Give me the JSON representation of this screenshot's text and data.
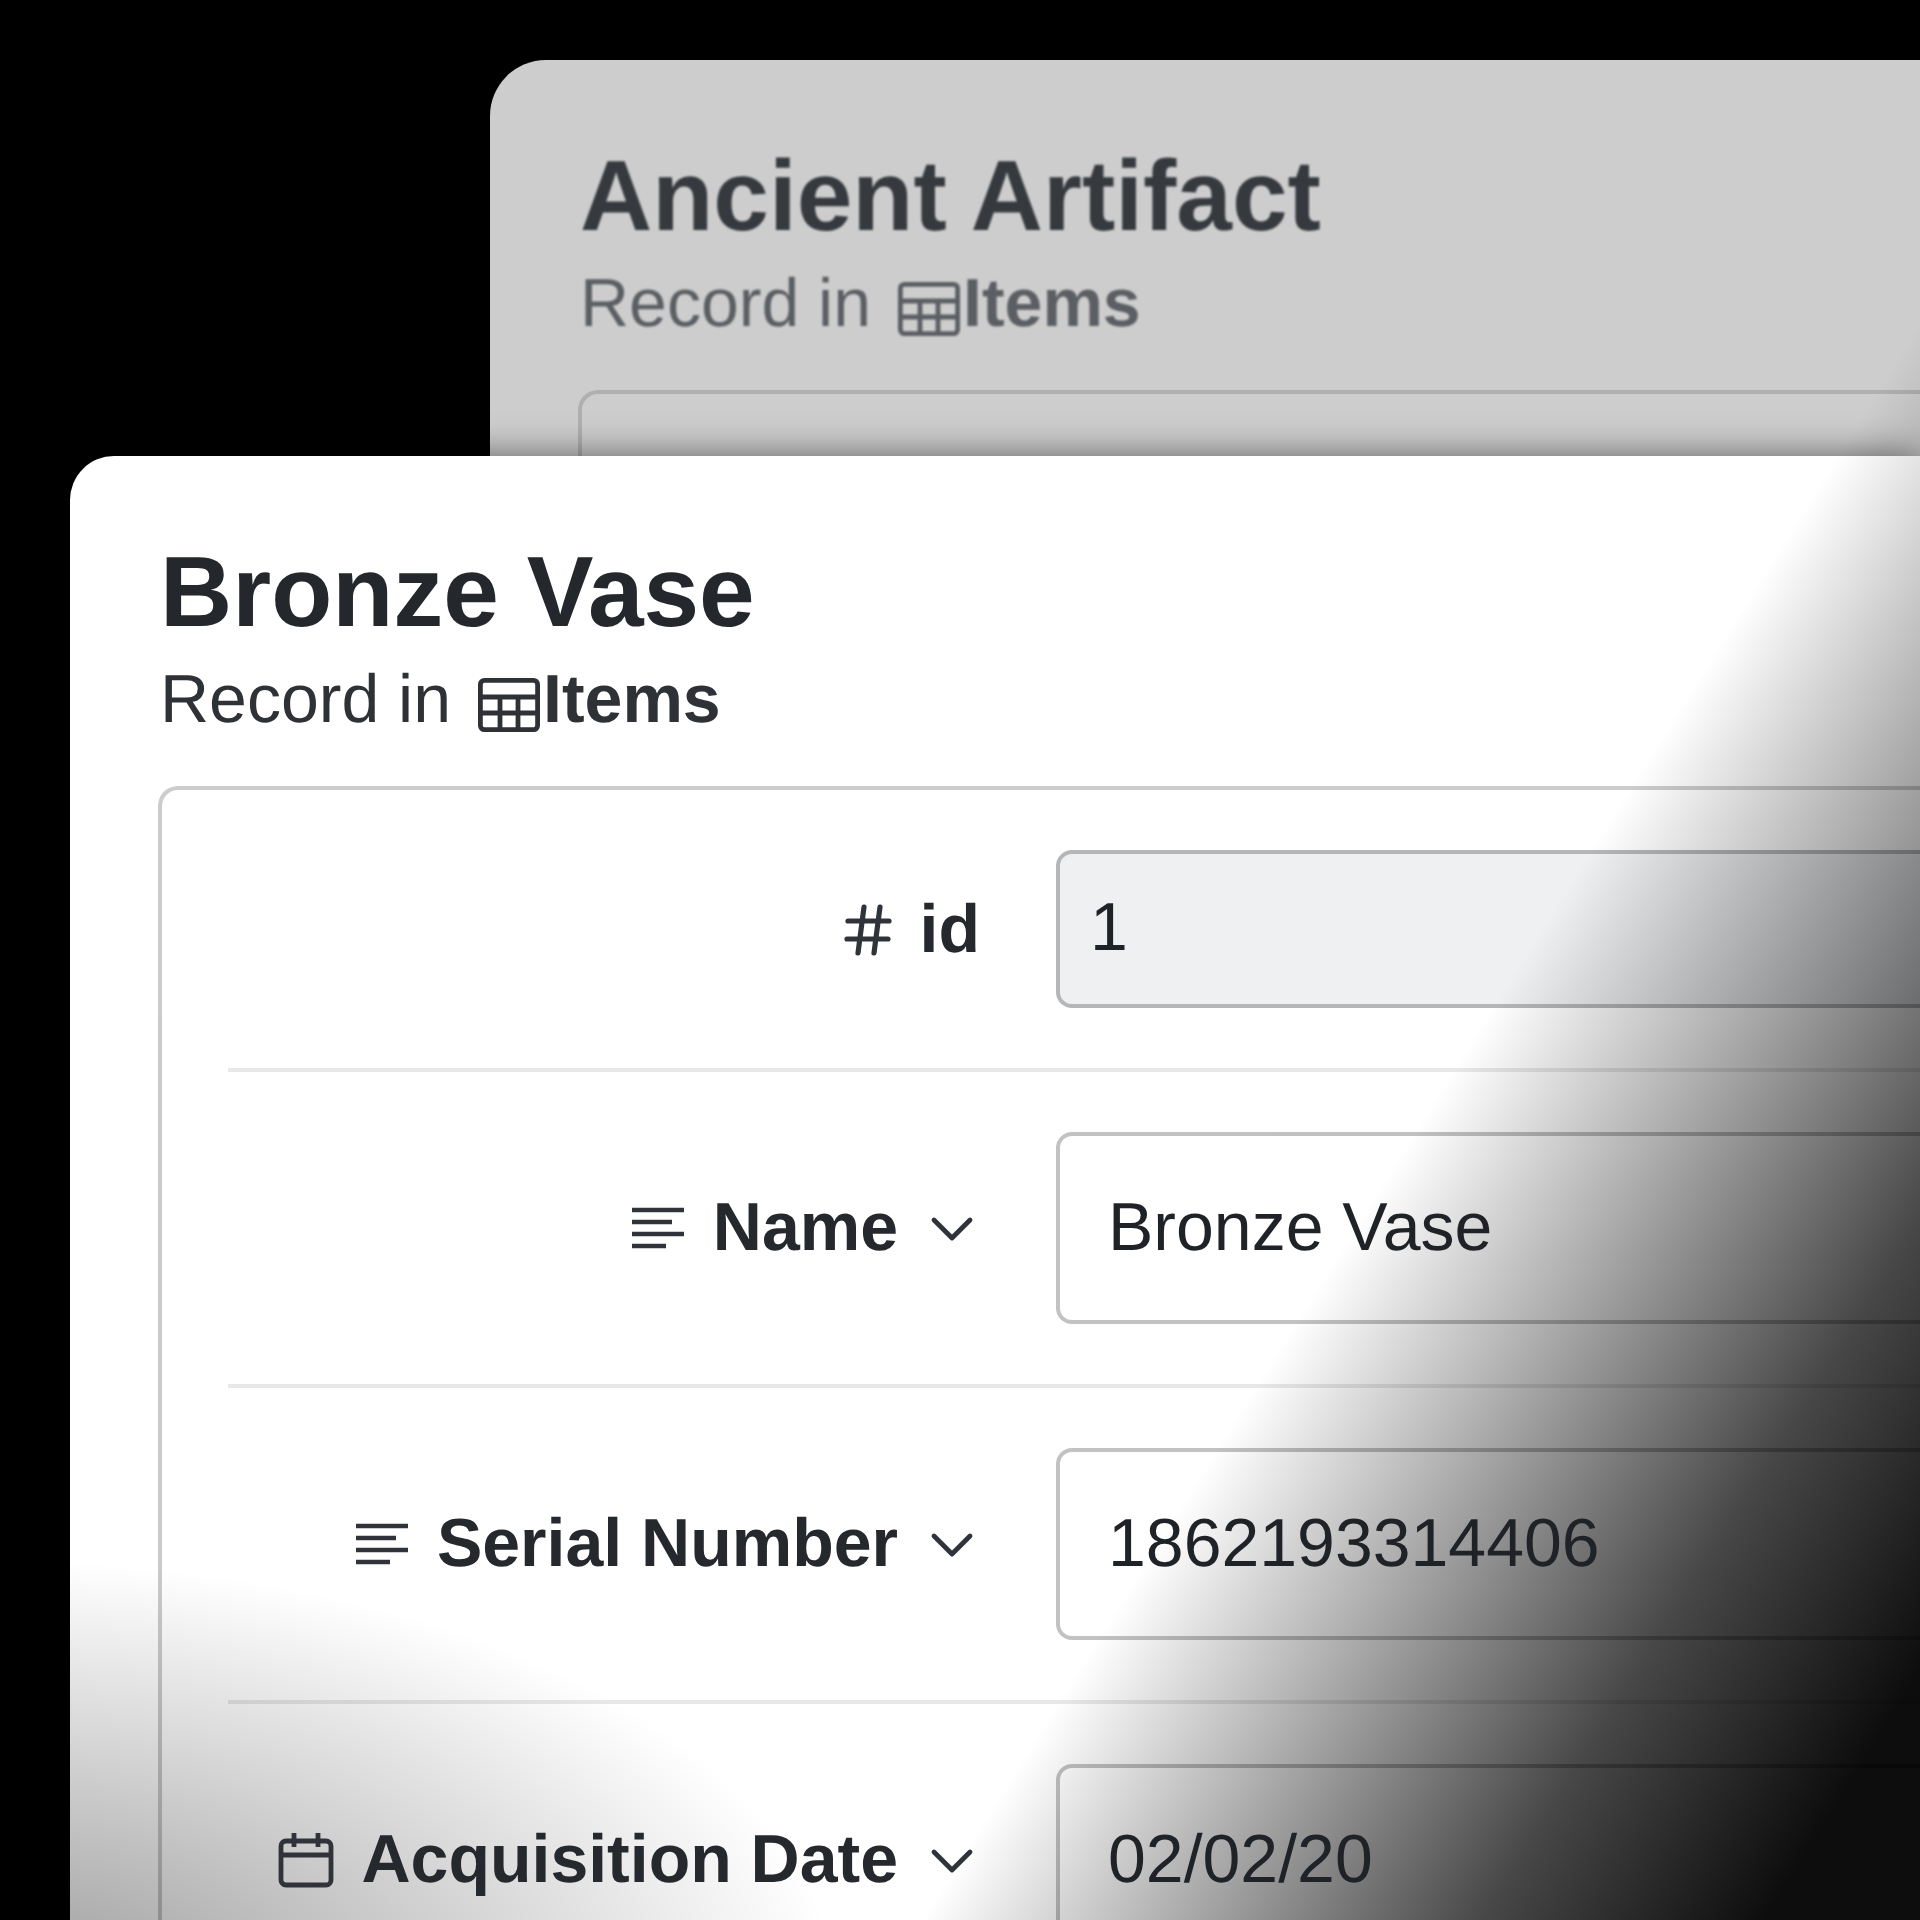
{
  "records": [
    {
      "active": false,
      "title": "Ancient Artifact",
      "subtitle": {
        "text": "Record in",
        "table": "Items"
      }
    },
    {
      "active": true,
      "title": "Bronze Vase",
      "subtitle": {
        "text": "Record in",
        "table": "Items"
      },
      "fields": [
        {
          "kind": "number",
          "label": "id",
          "menu": false,
          "disabled": true,
          "value": "1"
        },
        {
          "kind": "text",
          "label": "Name",
          "menu": true,
          "disabled": false,
          "value": "Bronze Vase"
        },
        {
          "kind": "text",
          "label": "Serial Number",
          "menu": true,
          "disabled": false,
          "value": "1862193314406"
        },
        {
          "kind": "date",
          "label": "Acquisition Date",
          "menu": true,
          "disabled": false,
          "value": "02/02/20"
        }
      ]
    }
  ]
}
